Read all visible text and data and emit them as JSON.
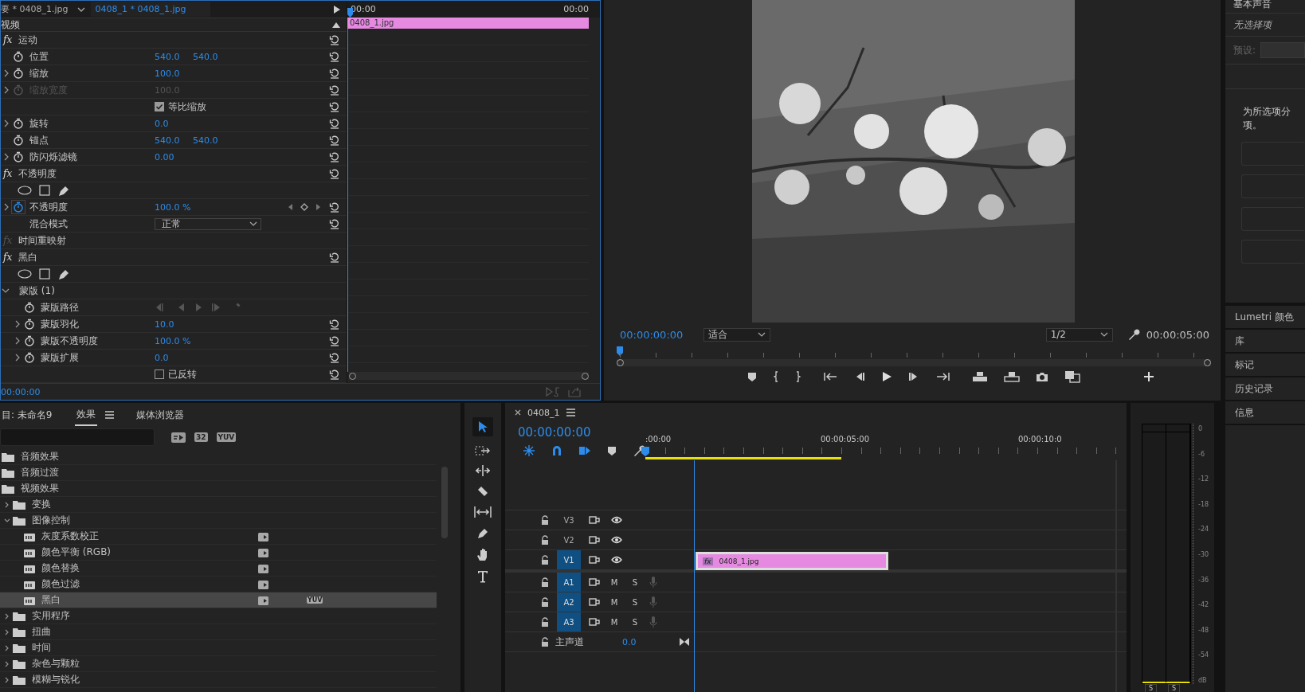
{
  "effect_controls": {
    "tabs": [
      {
        "label": "要 * 0408_1.jpg",
        "selected": false
      },
      {
        "label": "0408_1 * 0408_1.jpg",
        "selected": true
      }
    ],
    "section": "视频",
    "effects": [
      {
        "name": "运动",
        "fx": "fx",
        "disabled": false,
        "rows": [
          {
            "kind": "param",
            "label": "位置",
            "values": [
              "540.0",
              "540.0"
            ],
            "expandable": false,
            "animated": false,
            "disabled": false
          },
          {
            "kind": "param",
            "label": "缩放",
            "values": [
              "100.0"
            ],
            "expandable": true,
            "animated": false,
            "disabled": false
          },
          {
            "kind": "param",
            "label": "缩放宽度",
            "values": [
              "100.0"
            ],
            "expandable": true,
            "animated": false,
            "disabled": true
          },
          {
            "kind": "checkbox",
            "label": "等比缩放",
            "checked": true
          },
          {
            "kind": "param",
            "label": "旋转",
            "values": [
              "0.0"
            ],
            "expandable": true,
            "animated": false,
            "disabled": false
          },
          {
            "kind": "param",
            "label": "锚点",
            "values": [
              "540.0",
              "540.0"
            ],
            "expandable": false,
            "animated": false,
            "disabled": false
          },
          {
            "kind": "param",
            "label": "防闪烁滤镜",
            "values": [
              "0.00"
            ],
            "expandable": true,
            "animated": false,
            "disabled": false
          }
        ]
      },
      {
        "name": "不透明度",
        "fx": "fx",
        "disabled": false,
        "rows": [
          {
            "kind": "mask_tools"
          },
          {
            "kind": "param",
            "label": "不透明度",
            "values": [
              "100.0 %"
            ],
            "expandable": true,
            "animated": true,
            "disabled": false
          },
          {
            "kind": "dropdown",
            "label": "混合模式",
            "value": "正常"
          }
        ]
      },
      {
        "name": "时间重映射",
        "fx": "fx",
        "disabled": true
      },
      {
        "name": "黑白",
        "fx": "fx",
        "disabled": false,
        "rows": [
          {
            "kind": "mask_tools"
          },
          {
            "kind": "group",
            "label": "蒙版 (1)",
            "expanded": true,
            "children": [
              {
                "kind": "mask_path",
                "label": "蒙版路径"
              },
              {
                "kind": "param",
                "label": "蒙版羽化",
                "values": [
                  "10.0"
                ],
                "expandable": true,
                "animated": false,
                "disabled": false
              },
              {
                "kind": "param",
                "label": "蒙版不透明度",
                "values": [
                  "100.0 %"
                ],
                "expandable": true,
                "animated": false,
                "disabled": false
              },
              {
                "kind": "param",
                "label": "蒙版扩展",
                "values": [
                  "0.0"
                ],
                "expandable": true,
                "animated": false,
                "disabled": false
              },
              {
                "kind": "checkbox",
                "label": "已反转",
                "checked": false
              }
            ]
          }
        ]
      }
    ],
    "mini_timeline": {
      "ruler": [
        "00:00",
        "00:00"
      ],
      "clip": "0408_1.jpg"
    },
    "footer_timecode": "00:00:00"
  },
  "program_monitor": {
    "timecode": "00:00:00:00",
    "fit": "适合",
    "resolution": "1/2",
    "duration": "00:00:05:00"
  },
  "effects_panel": {
    "tabs": [
      {
        "label": "目: 未命名9",
        "selected": false
      },
      {
        "label": "效果",
        "selected": true
      },
      {
        "label": "媒体浏览器",
        "selected": false
      }
    ],
    "filters": [
      {
        "kind": "accelerated"
      },
      {
        "kind": "bit32",
        "label": "32"
      },
      {
        "kind": "yuv",
        "label": "YUV"
      }
    ],
    "tree": [
      {
        "label": "音频效果",
        "kind": "folder"
      },
      {
        "label": "音频过渡",
        "kind": "folder"
      },
      {
        "label": "视频效果",
        "kind": "folder",
        "children": [
          {
            "label": "变换",
            "kind": "folder",
            "expanded": false
          },
          {
            "label": "图像控制",
            "kind": "folder",
            "expanded": true,
            "children": [
              {
                "label": "灰度系数校正",
                "kind": "effect",
                "accelerated": true,
                "selected": false
              },
              {
                "label": "颜色平衡 (RGB)",
                "kind": "effect",
                "accelerated": true,
                "selected": false
              },
              {
                "label": "颜色替换",
                "kind": "effect",
                "accelerated": true,
                "selected": false
              },
              {
                "label": "颜色过滤",
                "kind": "effect",
                "accelerated": true,
                "selected": false
              },
              {
                "label": "黑白",
                "kind": "effect",
                "accelerated": true,
                "selected": true,
                "badges": [
                  "YUV"
                ]
              }
            ]
          },
          {
            "label": "实用程序",
            "kind": "folder",
            "expanded": false
          },
          {
            "label": "扭曲",
            "kind": "folder",
            "expanded": false
          },
          {
            "label": "时间",
            "kind": "folder",
            "expanded": false
          },
          {
            "label": "杂色与颗粒",
            "kind": "folder",
            "expanded": false
          },
          {
            "label": "模糊与锐化",
            "kind": "folder",
            "expanded": false
          }
        ]
      }
    ]
  },
  "timeline": {
    "tab": "0408_1",
    "timecode": "00:00:00:00",
    "ruler": [
      ":00:00",
      "00:00:05:00",
      "00:00:10:0"
    ],
    "tracks": [
      {
        "name": "V3",
        "kind": "video",
        "targeted": false
      },
      {
        "name": "V2",
        "kind": "video",
        "targeted": false
      },
      {
        "name": "V1",
        "kind": "video",
        "targeted": true,
        "clips": [
          {
            "name": "0408_1.jpg",
            "fx": "fx"
          }
        ]
      },
      {
        "name": "A1",
        "kind": "audio",
        "targeted": true,
        "mute": "M",
        "solo": "S"
      },
      {
        "name": "A2",
        "kind": "audio",
        "targeted": true,
        "mute": "M",
        "solo": "S"
      },
      {
        "name": "A3",
        "kind": "audio",
        "targeted": true,
        "mute": "M",
        "solo": "S"
      }
    ],
    "master": {
      "label": "主声道",
      "value": "0.0"
    }
  },
  "audio_meter": {
    "scale": [
      "0",
      "-6",
      "-12",
      "-18",
      "-24",
      "-30",
      "-36",
      "-42",
      "-48",
      "-54",
      "dB"
    ],
    "solo": [
      "S",
      "S"
    ]
  },
  "right_panel": {
    "title": "基本声音",
    "status": "无选择项",
    "preset_label": "预设:",
    "message": [
      "为所选项分",
      "项。"
    ],
    "panels": [
      "Lumetri 颜色",
      "库",
      "标记",
      "历史记录",
      "信息"
    ]
  }
}
